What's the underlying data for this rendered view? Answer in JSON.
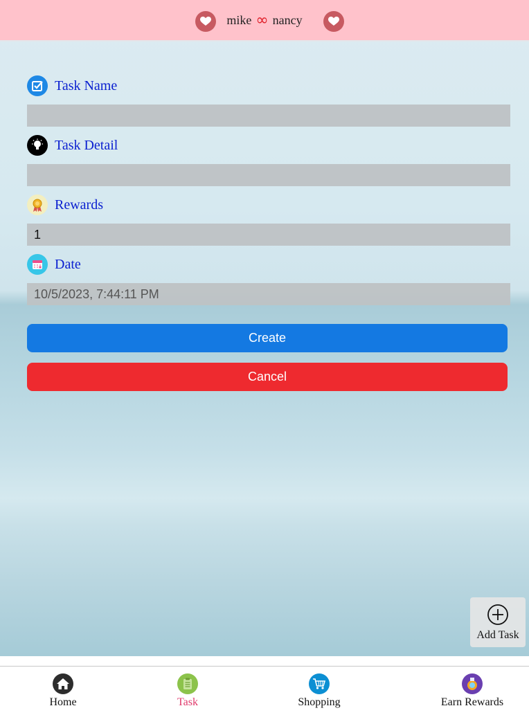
{
  "header": {
    "left_name": "mike",
    "infinity": "∞",
    "right_name": "nancy"
  },
  "form": {
    "task_name": {
      "label": "Task Name",
      "icon": "checkbox-icon",
      "value": ""
    },
    "task_detail": {
      "label": "Task Detail",
      "icon": "lightbulb-icon",
      "value": ""
    },
    "rewards": {
      "label": "Rewards",
      "icon": "medal-icon",
      "value": "1"
    },
    "date": {
      "label": "Date",
      "icon": "calendar-icon",
      "value": "10/5/2023, 7:44:11 PM"
    }
  },
  "buttons": {
    "create": "Create",
    "cancel": "Cancel"
  },
  "add_task": {
    "label": "Add Task",
    "icon": "plus-circle-icon"
  },
  "nav": {
    "home": "Home",
    "task": "Task",
    "shopping": "Shopping",
    "earn_rewards": "Earn Rewards",
    "active": "task"
  },
  "colors": {
    "header_bg": "#ffc2cb",
    "label_text": "#0a1fd0",
    "create_button": "#1479e2",
    "cancel_button": "#ee2a2f",
    "active_nav": "#e0396b"
  }
}
